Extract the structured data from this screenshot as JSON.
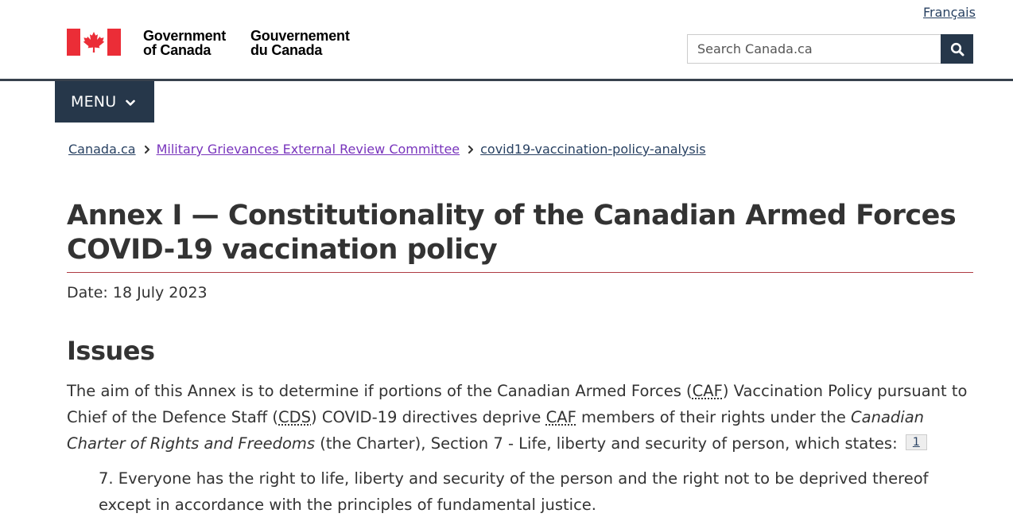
{
  "header": {
    "language_toggle": "Français",
    "signature_en_line1": "Government",
    "signature_en_line2": "of Canada",
    "signature_fr_line1": "Gouvernement",
    "signature_fr_line2": "du Canada",
    "flag_icon": "canada-flag-icon",
    "search": {
      "placeholder": "Search Canada.ca",
      "button_icon": "search-icon"
    },
    "colors": {
      "flag_red": "#eb2d37",
      "nav_dark": "#26374a",
      "visited_link": "#7834bc",
      "title_rule": "#af3c43"
    }
  },
  "menu": {
    "label": "MENU",
    "icon": "chevron-down-icon"
  },
  "breadcrumb": {
    "items": [
      "Canada.ca",
      "Military Grievances External Review Committee",
      "covid19-vaccination-policy-analysis"
    ],
    "separator_icon": "chevron-right-icon"
  },
  "main": {
    "title": "Annex I — Constitutionality of the Canadian Armed Forces COVID-19 vaccination policy",
    "date": "Date: 18 July 2023",
    "section_heading": "Issues",
    "paragraph": {
      "part1": "The aim of this Annex is to determine if portions of the Canadian Armed Forces (",
      "abbr_caf": "CAF",
      "part2": ") Vaccination Policy pursuant to Chief of the Defence Staff (",
      "abbr_cds": "CDS",
      "part3": ") COVID-19 directives deprive ",
      "abbr_caf_2": "CAF",
      "part4": " members of their rights under the ",
      "italic_charter": "Canadian Charter of Rights and Freedoms",
      "part5": " (the Charter), Section 7 - Life, liberty and security of person, which states: ",
      "footnote": "1"
    },
    "quote": "7. Everyone has the right to life, liberty and security of the person and the right not to be deprived thereof except in accordance with the principles of fundamental justice."
  }
}
